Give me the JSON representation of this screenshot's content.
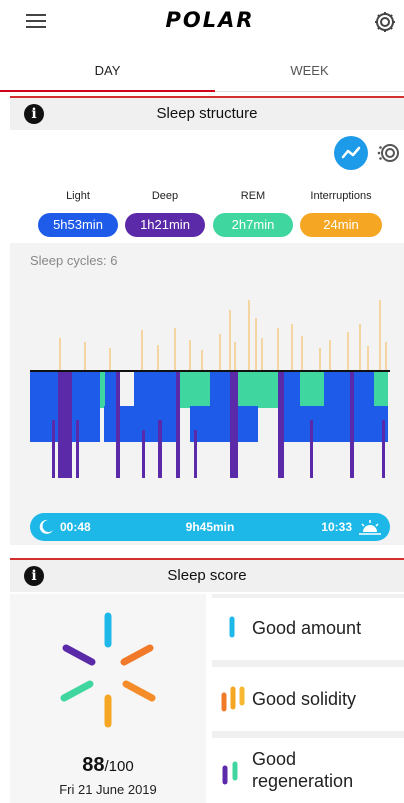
{
  "app": {
    "brand": "POLAR"
  },
  "tabs": [
    {
      "label": "DAY",
      "active": true
    },
    {
      "label": "WEEK",
      "active": false
    }
  ],
  "sleep_structure": {
    "title": "Sleep structure",
    "stages": [
      {
        "label": "Light",
        "value": "5h53min",
        "color": "#1e5be8"
      },
      {
        "label": "Deep",
        "value": "1h21min",
        "color": "#5b2aa8"
      },
      {
        "label": "REM",
        "value": "2h7min",
        "color": "#3fd6a0"
      },
      {
        "label": "Interruptions",
        "value": "24min",
        "color": "#f5a623"
      }
    ],
    "cycles_label": "Sleep cycles: 6",
    "sleep_start": "00:48",
    "total_duration": "9h45min",
    "wake_time": "10:33"
  },
  "sleep_score": {
    "title": "Sleep score",
    "score": "88",
    "score_max": "/100",
    "date": "Fri 21 June 2019",
    "items": [
      {
        "label": "Good amount"
      },
      {
        "label": "Good solidity"
      },
      {
        "label": "Good regeneration"
      }
    ]
  },
  "colors": {
    "accent_red": "#d32f2f",
    "timebar": "#1eb8e8",
    "light": "#1e5be8",
    "deep": "#5b2aa8",
    "rem": "#3fd6a0",
    "interruption": "#f5a623"
  }
}
